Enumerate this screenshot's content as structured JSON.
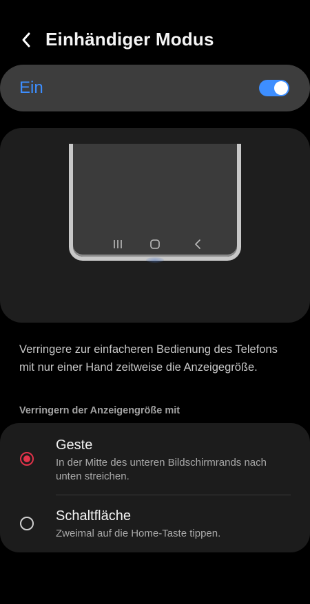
{
  "header": {
    "title": "Einhändiger Modus",
    "back_icon": "chevron-left-icon"
  },
  "master_switch": {
    "label": "Ein",
    "state": "on",
    "accent_color": "#3d8eff"
  },
  "preview": {
    "nav_icons": [
      "recents-icon",
      "home-icon",
      "back-icon"
    ]
  },
  "description": "Verringere zur einfacheren Bedienung des Telefons mit nur einer Hand zeitweise die Anzeigegröße.",
  "options_section": {
    "header": "Verringern der Anzeigengröße mit",
    "selected_color": "#e2334a",
    "options": [
      {
        "title": "Geste",
        "subtitle": "In der Mitte des unteren Bildschirmrands nach unten streichen.",
        "selected": true
      },
      {
        "title": "Schaltfläche",
        "subtitle": "Zweimal auf die Home-Taste tippen.",
        "selected": false
      }
    ]
  }
}
